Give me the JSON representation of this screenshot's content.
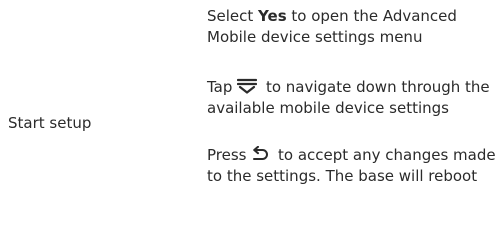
{
  "row": {
    "label": "Start setup",
    "steps": [
      {
        "prefix": "Select ",
        "bold": "Yes",
        "suffix": " to open the Advanced Mobile device settings menu"
      },
      {
        "prefix": "Tap ",
        "icon": "scroll-down-icon",
        "suffix": " to navigate down through the available mobile device settings"
      },
      {
        "prefix": "Press ",
        "icon": "back-return-icon",
        "suffix": " to accept any changes made to the settings. The base will reboot"
      }
    ]
  }
}
